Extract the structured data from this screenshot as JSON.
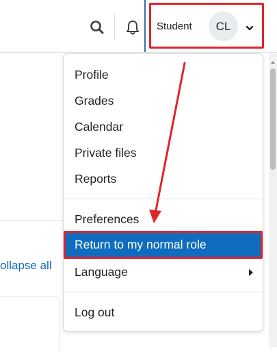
{
  "header": {
    "role": "Student",
    "avatar_initials": "CL"
  },
  "page": {
    "collapse_all_label": "ollapse all"
  },
  "user_menu": {
    "group1": [
      {
        "label": "Profile"
      },
      {
        "label": "Grades"
      },
      {
        "label": "Calendar"
      },
      {
        "label": "Private files"
      },
      {
        "label": "Reports"
      }
    ],
    "group2": [
      {
        "label": "Preferences"
      },
      {
        "label": "Return to my normal role"
      },
      {
        "label": "Language"
      }
    ],
    "group3": [
      {
        "label": "Log out"
      }
    ]
  },
  "colors": {
    "accent": "#0f6cbf",
    "highlight": "#e0252b",
    "avatar_bg": "#e9ecef"
  }
}
